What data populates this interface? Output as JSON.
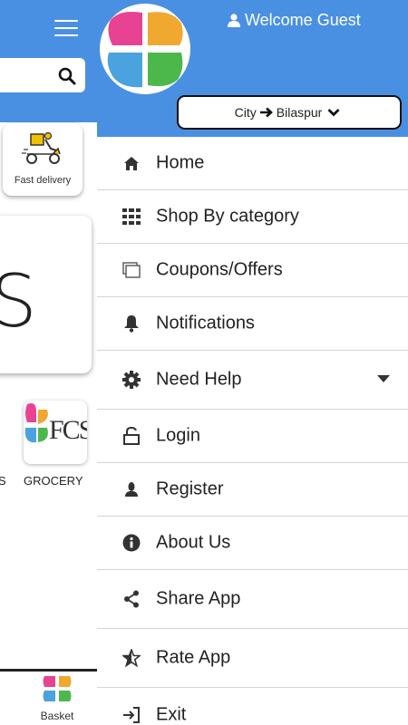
{
  "background": {
    "fast_delivery_label": "Fast delivery",
    "banner_text": "S",
    "fcs_logo_text": "FCS",
    "categories": [
      "S",
      "GROCERY"
    ],
    "bottom_nav": {
      "basket_label": "Basket"
    }
  },
  "drawer": {
    "welcome_text": "Welcome Guest",
    "city": {
      "prefix": "City",
      "value": "Bilaspur"
    },
    "menu": [
      {
        "label": "Home",
        "icon": "home-icon"
      },
      {
        "label": "Shop By category",
        "icon": "grid-icon"
      },
      {
        "label": "Coupons/Offers",
        "icon": "coupons-icon"
      },
      {
        "label": "Notifications",
        "icon": "bell-icon"
      },
      {
        "label": "Need Help",
        "icon": "gear-icon"
      },
      {
        "label": "Login",
        "icon": "unlock-icon"
      },
      {
        "label": "Register",
        "icon": "user-icon"
      },
      {
        "label": "About Us",
        "icon": "info-icon"
      },
      {
        "label": "Share App",
        "icon": "share-icon"
      },
      {
        "label": "Rate App",
        "icon": "star-icon"
      },
      {
        "label": "Exit",
        "icon": "exit-icon"
      }
    ]
  },
  "colors": {
    "header_blue": "#4a90e2",
    "logo_pink": "#e84393",
    "logo_orange": "#f0a830",
    "logo_blue": "#4aa3df",
    "logo_green": "#4cb84c"
  }
}
